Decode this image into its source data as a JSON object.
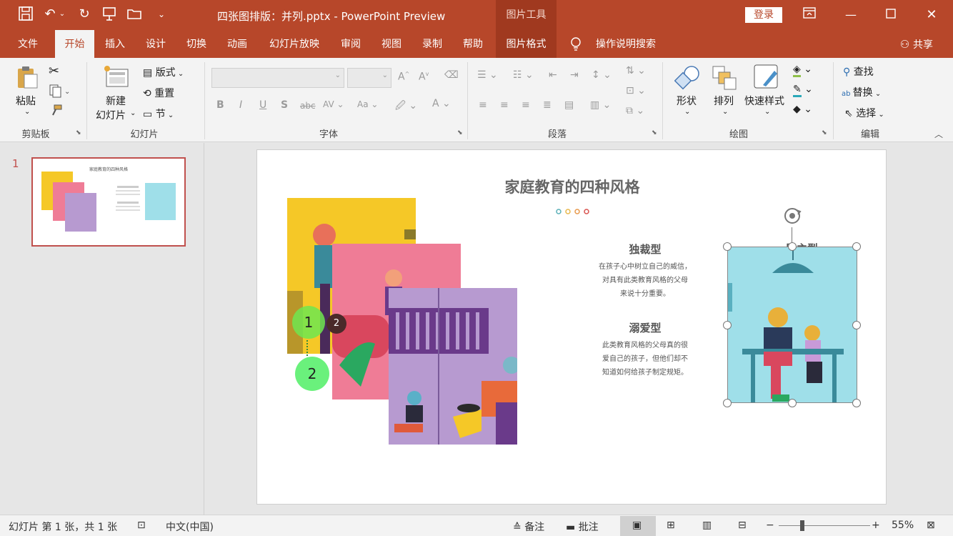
{
  "titlebar": {
    "doc_title": "四张图排版：并列.pptx  -  PowerPoint Preview",
    "context_tool": "图片工具",
    "login": "登录",
    "accent": "#b7472a"
  },
  "tabs": [
    "文件",
    "开始",
    "插入",
    "设计",
    "切换",
    "动画",
    "幻灯片放映",
    "审阅",
    "视图",
    "录制",
    "帮助",
    "图片格式"
  ],
  "tell_me": "操作说明搜索",
  "share": "共享",
  "ribbon": {
    "clipboard": {
      "paste": "粘贴",
      "label": "剪贴板"
    },
    "slides": {
      "new_slide_1": "新建",
      "new_slide_2": "幻灯片",
      "layout": "版式",
      "reset": "重置",
      "section": "节",
      "label": "幻灯片"
    },
    "font": {
      "label": "字体"
    },
    "paragraph": {
      "label": "段落"
    },
    "drawing": {
      "shapes": "形状",
      "arrange": "排列",
      "quick_styles": "快速样式",
      "label": "绘图"
    },
    "editing": {
      "find": "查找",
      "replace": "替换",
      "select": "选择",
      "label": "编辑"
    }
  },
  "thumbnail": {
    "number": "1",
    "title": "家庭教育的四种风格"
  },
  "slide": {
    "title": "家庭教育的四种风格",
    "dot_colors": [
      "#5bb0b8",
      "#e8b84d",
      "#e89a4d",
      "#d9534f"
    ],
    "section1_title": "独裁型",
    "section1_lines": [
      "在孩子心中树立自己的威信，",
      "对具有此类教育风格的父母",
      "来说十分重要。"
    ],
    "section2_title": "溺爱型",
    "section2_lines": [
      "此类教育风格的父母真的很",
      "爱自己的孩子，但他们却不",
      "知道如何给孩子制定规矩。"
    ],
    "hidden_title_partial": "民主型",
    "markers": [
      "1",
      "2",
      "2"
    ]
  },
  "status": {
    "slide_info": "幻灯片 第 1 张，共 1 张",
    "language": "中文(中国)",
    "notes": "备注",
    "comments": "批注",
    "zoom": "55%"
  }
}
